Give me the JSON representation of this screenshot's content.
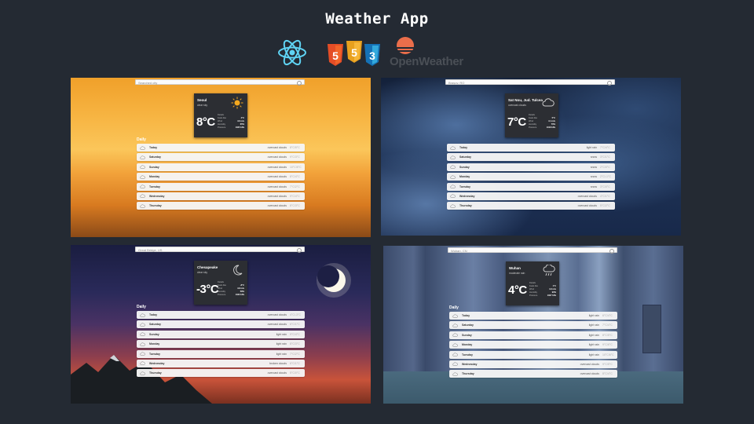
{
  "title": "Weather App",
  "logos": {
    "react": "react-icon",
    "html5": {
      "glyph": "5",
      "color": "#e44d26"
    },
    "js": {
      "glyph": "5",
      "color": "#f0a628"
    },
    "css3": {
      "glyph": "3",
      "color": "#1572b6"
    },
    "openweather": "OpenWeather"
  },
  "screens": [
    {
      "search": "Searched city",
      "city": "Seoul",
      "desc": "clear sky",
      "temp": "8°C",
      "icon": "sun-icon",
      "details": [
        [
          "Details",
          ""
        ],
        [
          "Feels like",
          "4°C"
        ],
        [
          "Wind",
          "3.6 m/s"
        ],
        [
          "Humidity",
          "65%"
        ],
        [
          "Pressure",
          "1025 hPa"
        ]
      ],
      "daily_label": "Daily",
      "days": [
        {
          "day": "Today",
          "desc": "overcast clouds",
          "range": "8°C/5°C"
        },
        {
          "day": "Saturday",
          "desc": "overcast clouds",
          "range": "9°C/3°C"
        },
        {
          "day": "Sunday",
          "desc": "overcast clouds",
          "range": "10°C/5°C"
        },
        {
          "day": "Monday",
          "desc": "overcast clouds",
          "range": "8°C/4°C"
        },
        {
          "day": "Tuesday",
          "desc": "overcast clouds",
          "range": "7°C/2°C"
        },
        {
          "day": "Wednesday",
          "desc": "overcast clouds",
          "range": "9°C/4°C"
        },
        {
          "day": "Thursday",
          "desc": "overcast clouds",
          "range": "8°C/3°C"
        }
      ]
    },
    {
      "search": "Brașov, RO",
      "city": "Sat Nou, Jud. Tulcea",
      "desc": "overcast clouds",
      "temp": "7°C",
      "icon": "cloud-icon",
      "details": [
        [
          "Details",
          ""
        ],
        [
          "Feels like",
          "5°C"
        ],
        [
          "Wind",
          "3.1 m/s"
        ],
        [
          "Humidity",
          "70%"
        ],
        [
          "Pressure",
          "1018 hPa"
        ]
      ],
      "daily_label": "",
      "days": [
        {
          "day": "Today",
          "desc": "light rain",
          "range": "7°C/4°C"
        },
        {
          "day": "Saturday",
          "desc": "snow",
          "range": "3°C/1°C"
        },
        {
          "day": "Sunday",
          "desc": "snow",
          "range": "2°C/0°C"
        },
        {
          "day": "Monday",
          "desc": "snow",
          "range": "2°C/-1°C"
        },
        {
          "day": "Tuesday",
          "desc": "snow",
          "range": "3°C/0°C"
        },
        {
          "day": "Wednesday",
          "desc": "overcast clouds",
          "range": "4°C/1°C"
        },
        {
          "day": "Thursday",
          "desc": "overcast clouds",
          "range": "5°C/2°C"
        }
      ]
    },
    {
      "search": "Great Bridge, US",
      "city": "Chesapeake",
      "desc": "clear sky",
      "temp": "-3°C",
      "icon": "moon-icon",
      "details": [
        [
          "Details",
          ""
        ],
        [
          "Feels like",
          "-8°C"
        ],
        [
          "Wind",
          "3.8 m/s"
        ],
        [
          "Humidity",
          "58%"
        ],
        [
          "Pressure",
          "1030 hPa"
        ]
      ],
      "daily_label": "Daily",
      "days": [
        {
          "day": "Today",
          "desc": "overcast clouds",
          "range": "4°C/-3°C"
        },
        {
          "day": "Saturday",
          "desc": "overcast clouds",
          "range": "6°C/1°C"
        },
        {
          "day": "Sunday",
          "desc": "light rain",
          "range": "9°C/4°C"
        },
        {
          "day": "Monday",
          "desc": "light rain",
          "range": "8°C/3°C"
        },
        {
          "day": "Tuesday",
          "desc": "light rain",
          "range": "7°C/2°C"
        },
        {
          "day": "Wednesday",
          "desc": "broken clouds",
          "range": "6°C/1°C"
        },
        {
          "day": "Thursday",
          "desc": "overcast clouds",
          "range": "5°C/0°C"
        }
      ]
    },
    {
      "search": "Wuhan, CN",
      "city": "Wuhan",
      "desc": "moderate rain",
      "temp": "4°C",
      "icon": "rain-icon",
      "details": [
        [
          "Details",
          ""
        ],
        [
          "Feels like",
          "1°C"
        ],
        [
          "Wind",
          "3.3 m/s"
        ],
        [
          "Humidity",
          "93%"
        ],
        [
          "Pressure",
          "1027 hPa"
        ]
      ],
      "daily_label": "Daily",
      "days": [
        {
          "day": "Today",
          "desc": "light rain",
          "range": "6°C/4°C"
        },
        {
          "day": "Saturday",
          "desc": "light rain",
          "range": "7°C/4°C"
        },
        {
          "day": "Sunday",
          "desc": "light rain",
          "range": "8°C/5°C"
        },
        {
          "day": "Monday",
          "desc": "light rain",
          "range": "9°C/6°C"
        },
        {
          "day": "Tuesday",
          "desc": "light rain",
          "range": "10°C/6°C"
        },
        {
          "day": "Wednesday",
          "desc": "overcast clouds",
          "range": "9°C/5°C"
        },
        {
          "day": "Thursday",
          "desc": "overcast clouds",
          "range": "8°C/4°C"
        }
      ]
    }
  ]
}
